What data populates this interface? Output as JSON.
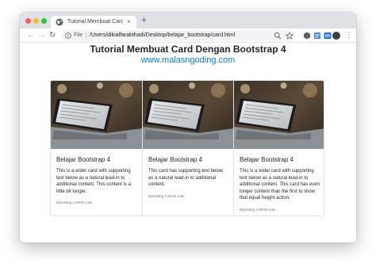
{
  "browser": {
    "tab_title": "Tutorial Membuat Card Dengan Bootstrap 4",
    "tab_close": "×",
    "new_tab": "+",
    "nav": {
      "back": "←",
      "forward": "→",
      "reload": "↻"
    },
    "scheme": "File",
    "url": "/Users/dikialfarabihadi/Desktop/belajar_bootstrap/card.html",
    "menu": "⋮"
  },
  "page": {
    "title": "Tutorial Membuat Card Dengan Bootstrap 4",
    "link": "www.malasngoding.com",
    "link_color": "#007bff"
  },
  "cards": [
    {
      "title": "Belajar Bootstrap 4",
      "text": "This is a wider card with supporting text below as a natural lead-in to additional content. This content is a little bit longer.",
      "footer": "Diposting 2 Menit Lalu"
    },
    {
      "title": "Belajar Bootstrap 4",
      "text": "This card has supporting text below as a natural lead-in to additional content.",
      "footer": "Diposting 2 Menit Lalu"
    },
    {
      "title": "Belajar Bootstrap 4",
      "text": "This is a wider card with supporting text below as a natural lead-in to additional content. This card has even longer content than the first to show that equal height action.",
      "footer": "Diposting 2 Menit Lalu"
    }
  ]
}
